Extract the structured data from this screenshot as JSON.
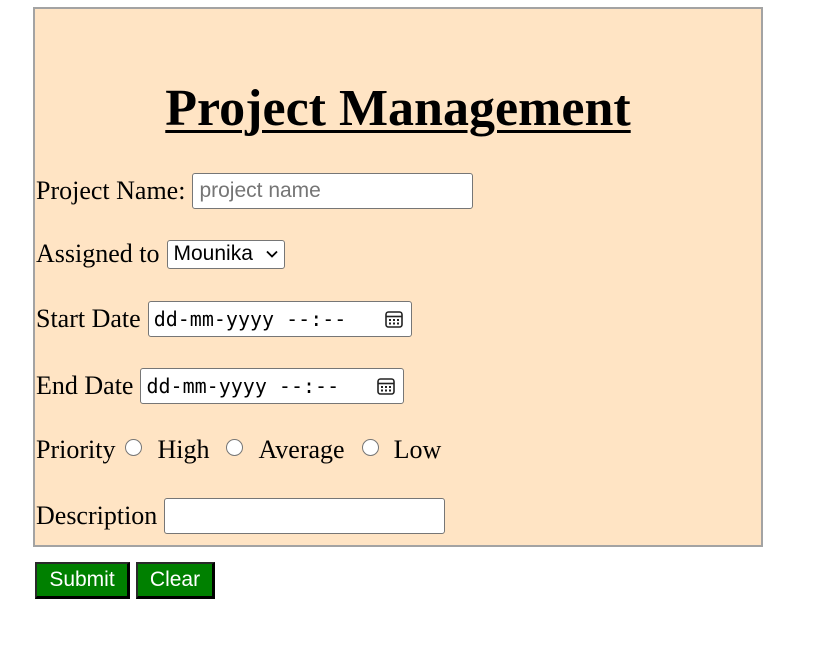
{
  "form": {
    "title": "Project Management",
    "project_name": {
      "label": "Project Name:",
      "placeholder": "project name",
      "value": ""
    },
    "assigned_to": {
      "label": "Assigned to",
      "selected": "Mounika"
    },
    "start_date": {
      "label": "Start Date",
      "display": "dd-mm-yyyy --:--"
    },
    "end_date": {
      "label": "End Date",
      "display": "dd-mm-yyyy --:--"
    },
    "priority": {
      "label": "Priority",
      "options": [
        "High",
        "Average",
        "Low"
      ],
      "selected": null
    },
    "description": {
      "label": "Description",
      "value": ""
    }
  },
  "buttons": {
    "submit_label": "Submit",
    "clear_label": "Clear"
  },
  "colors": {
    "form_background": "#ffe4c4",
    "button_background": "#008000",
    "button_text": "#ffffff"
  },
  "icons": {
    "select": "chevron-down-icon",
    "date": "calendar-icon"
  }
}
